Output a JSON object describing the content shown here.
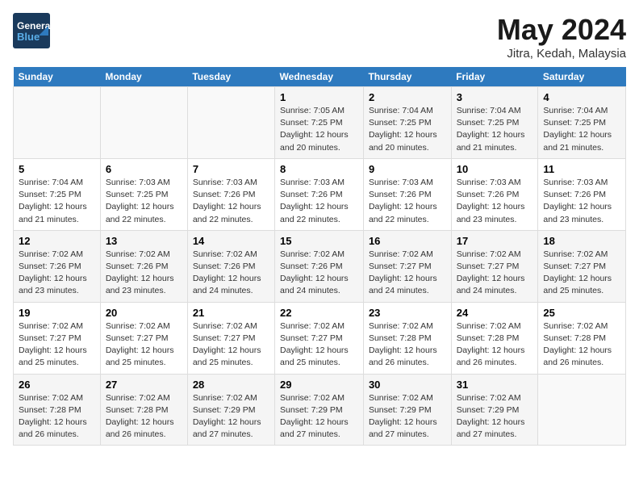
{
  "header": {
    "logo_line1": "General",
    "logo_line2": "Blue",
    "month_title": "May 2024",
    "location": "Jitra, Kedah, Malaysia"
  },
  "weekdays": [
    "Sunday",
    "Monday",
    "Tuesday",
    "Wednesday",
    "Thursday",
    "Friday",
    "Saturday"
  ],
  "weeks": [
    [
      {
        "day": "",
        "info": ""
      },
      {
        "day": "",
        "info": ""
      },
      {
        "day": "",
        "info": ""
      },
      {
        "day": "1",
        "info": "Sunrise: 7:05 AM\nSunset: 7:25 PM\nDaylight: 12 hours\nand 20 minutes."
      },
      {
        "day": "2",
        "info": "Sunrise: 7:04 AM\nSunset: 7:25 PM\nDaylight: 12 hours\nand 20 minutes."
      },
      {
        "day": "3",
        "info": "Sunrise: 7:04 AM\nSunset: 7:25 PM\nDaylight: 12 hours\nand 21 minutes."
      },
      {
        "day": "4",
        "info": "Sunrise: 7:04 AM\nSunset: 7:25 PM\nDaylight: 12 hours\nand 21 minutes."
      }
    ],
    [
      {
        "day": "5",
        "info": "Sunrise: 7:04 AM\nSunset: 7:25 PM\nDaylight: 12 hours\nand 21 minutes."
      },
      {
        "day": "6",
        "info": "Sunrise: 7:03 AM\nSunset: 7:25 PM\nDaylight: 12 hours\nand 22 minutes."
      },
      {
        "day": "7",
        "info": "Sunrise: 7:03 AM\nSunset: 7:26 PM\nDaylight: 12 hours\nand 22 minutes."
      },
      {
        "day": "8",
        "info": "Sunrise: 7:03 AM\nSunset: 7:26 PM\nDaylight: 12 hours\nand 22 minutes."
      },
      {
        "day": "9",
        "info": "Sunrise: 7:03 AM\nSunset: 7:26 PM\nDaylight: 12 hours\nand 22 minutes."
      },
      {
        "day": "10",
        "info": "Sunrise: 7:03 AM\nSunset: 7:26 PM\nDaylight: 12 hours\nand 23 minutes."
      },
      {
        "day": "11",
        "info": "Sunrise: 7:03 AM\nSunset: 7:26 PM\nDaylight: 12 hours\nand 23 minutes."
      }
    ],
    [
      {
        "day": "12",
        "info": "Sunrise: 7:02 AM\nSunset: 7:26 PM\nDaylight: 12 hours\nand 23 minutes."
      },
      {
        "day": "13",
        "info": "Sunrise: 7:02 AM\nSunset: 7:26 PM\nDaylight: 12 hours\nand 23 minutes."
      },
      {
        "day": "14",
        "info": "Sunrise: 7:02 AM\nSunset: 7:26 PM\nDaylight: 12 hours\nand 24 minutes."
      },
      {
        "day": "15",
        "info": "Sunrise: 7:02 AM\nSunset: 7:26 PM\nDaylight: 12 hours\nand 24 minutes."
      },
      {
        "day": "16",
        "info": "Sunrise: 7:02 AM\nSunset: 7:27 PM\nDaylight: 12 hours\nand 24 minutes."
      },
      {
        "day": "17",
        "info": "Sunrise: 7:02 AM\nSunset: 7:27 PM\nDaylight: 12 hours\nand 24 minutes."
      },
      {
        "day": "18",
        "info": "Sunrise: 7:02 AM\nSunset: 7:27 PM\nDaylight: 12 hours\nand 25 minutes."
      }
    ],
    [
      {
        "day": "19",
        "info": "Sunrise: 7:02 AM\nSunset: 7:27 PM\nDaylight: 12 hours\nand 25 minutes."
      },
      {
        "day": "20",
        "info": "Sunrise: 7:02 AM\nSunset: 7:27 PM\nDaylight: 12 hours\nand 25 minutes."
      },
      {
        "day": "21",
        "info": "Sunrise: 7:02 AM\nSunset: 7:27 PM\nDaylight: 12 hours\nand 25 minutes."
      },
      {
        "day": "22",
        "info": "Sunrise: 7:02 AM\nSunset: 7:27 PM\nDaylight: 12 hours\nand 25 minutes."
      },
      {
        "day": "23",
        "info": "Sunrise: 7:02 AM\nSunset: 7:28 PM\nDaylight: 12 hours\nand 26 minutes."
      },
      {
        "day": "24",
        "info": "Sunrise: 7:02 AM\nSunset: 7:28 PM\nDaylight: 12 hours\nand 26 minutes."
      },
      {
        "day": "25",
        "info": "Sunrise: 7:02 AM\nSunset: 7:28 PM\nDaylight: 12 hours\nand 26 minutes."
      }
    ],
    [
      {
        "day": "26",
        "info": "Sunrise: 7:02 AM\nSunset: 7:28 PM\nDaylight: 12 hours\nand 26 minutes."
      },
      {
        "day": "27",
        "info": "Sunrise: 7:02 AM\nSunset: 7:28 PM\nDaylight: 12 hours\nand 26 minutes."
      },
      {
        "day": "28",
        "info": "Sunrise: 7:02 AM\nSunset: 7:29 PM\nDaylight: 12 hours\nand 27 minutes."
      },
      {
        "day": "29",
        "info": "Sunrise: 7:02 AM\nSunset: 7:29 PM\nDaylight: 12 hours\nand 27 minutes."
      },
      {
        "day": "30",
        "info": "Sunrise: 7:02 AM\nSunset: 7:29 PM\nDaylight: 12 hours\nand 27 minutes."
      },
      {
        "day": "31",
        "info": "Sunrise: 7:02 AM\nSunset: 7:29 PM\nDaylight: 12 hours\nand 27 minutes."
      },
      {
        "day": "",
        "info": ""
      }
    ]
  ]
}
